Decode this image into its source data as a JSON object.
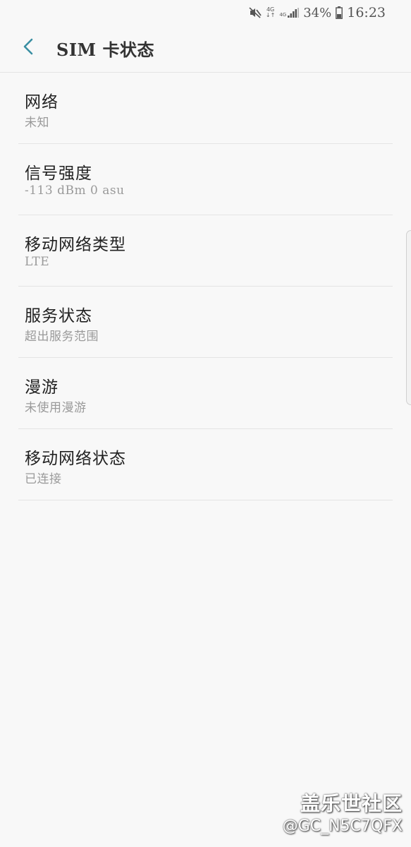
{
  "status_bar": {
    "net_top": "4G",
    "net_arrows": "↓↑",
    "signal_label": "4G",
    "battery_percent": "34%",
    "time": "16:23",
    "icons": [
      "mute-icon",
      "data-4g-icon",
      "signal-icon",
      "battery-icon"
    ]
  },
  "header": {
    "title": "SIM 卡状态",
    "back_icon": "chevron-left-icon",
    "accent_color": "#3a8fa3"
  },
  "items": [
    {
      "title": "网络",
      "value": "未知"
    },
    {
      "title": "信号强度",
      "value": "-113 dBm 0 asu"
    },
    {
      "title": "移动网络类型",
      "value": "LTE"
    },
    {
      "title": "服务状态",
      "value": "超出服务范围"
    },
    {
      "title": "漫游",
      "value": "未使用漫游"
    },
    {
      "title": "移动网络状态",
      "value": "已连接"
    }
  ],
  "watermark": {
    "title": "盖乐世社区",
    "handle": "@GC_N5C7QFX"
  }
}
